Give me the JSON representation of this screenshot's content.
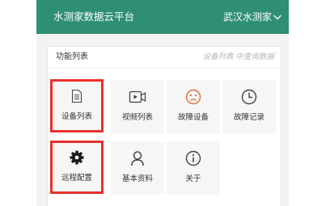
{
  "header": {
    "title": "水测家数据云平台",
    "region": "武汉水测家"
  },
  "panel": {
    "title": "功能列表",
    "hint": "设备列表 中查询数据"
  },
  "tiles": [
    {
      "label": "设备列表",
      "icon": "document-list-icon"
    },
    {
      "label": "视频列表",
      "icon": "video-camera-icon"
    },
    {
      "label": "故障设备",
      "icon": "sad-face-icon"
    },
    {
      "label": "故障记录",
      "icon": "clock-icon"
    },
    {
      "label": "远程配置",
      "icon": "gear-icon"
    },
    {
      "label": "基本资料",
      "icon": "user-icon"
    },
    {
      "label": "关于",
      "icon": "info-icon"
    }
  ],
  "colors": {
    "header_bg": "#2f8f75",
    "highlight_border": "#e8312b",
    "fault_icon": "#e06a3a"
  }
}
